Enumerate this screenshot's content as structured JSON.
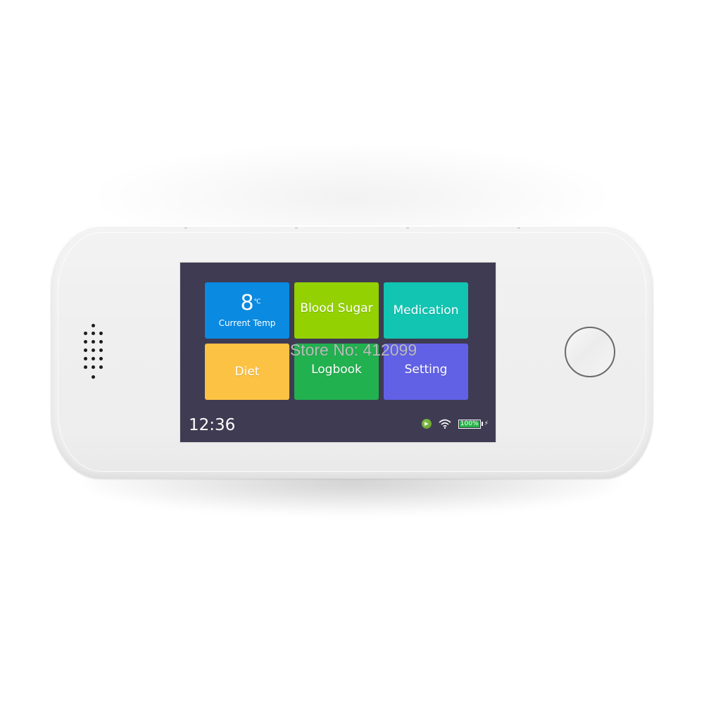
{
  "device": {
    "screen": {
      "tiles": [
        {
          "id": "current-temp",
          "value": "8",
          "unit": "℃",
          "label": "Current Temp",
          "color": "#0a8ae0"
        },
        {
          "id": "blood-sugar",
          "label": "Blood Sugar",
          "color": "#93d102"
        },
        {
          "id": "medication",
          "label": "Medication",
          "color": "#12c4b2"
        },
        {
          "id": "diet",
          "label": "Diet",
          "color": "#fcc244"
        },
        {
          "id": "logbook",
          "label": "Logbook",
          "color": "#22b14f"
        },
        {
          "id": "setting",
          "label": "Setting",
          "color": "#6161e6"
        }
      ],
      "status_bar": {
        "time": "12:36",
        "icons": [
          "sync-icon",
          "wifi-icon",
          "battery-icon",
          "charging-icon"
        ],
        "battery_level": "100%",
        "battery_fraction": 1.0,
        "battery_color": "#27b34a"
      },
      "background_color": "#3f3b52"
    },
    "watermark": "Store No: 412099"
  }
}
